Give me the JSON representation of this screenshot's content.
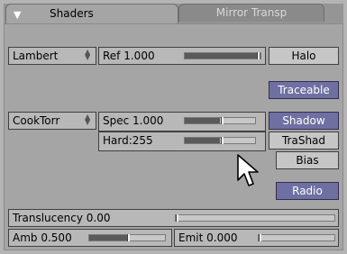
{
  "tabs": {
    "active": "Shaders",
    "inactive": "Mirror Transp"
  },
  "diffuse": {
    "shader": "Lambert",
    "ref": {
      "label": "Ref ",
      "value": "1.000",
      "fraction": 1.0
    }
  },
  "specular": {
    "shader": "CookTorr",
    "spec": {
      "label": "Spec ",
      "value": "1.000",
      "fraction": 0.5
    },
    "hard": {
      "label": "Hard:",
      "value": "255",
      "fraction": 0.5
    }
  },
  "toggles": {
    "halo": {
      "label": "Halo",
      "on": false
    },
    "traceable": {
      "label": "Traceable",
      "on": true
    },
    "shadow": {
      "label": "Shadow",
      "on": true
    },
    "trashad": {
      "label": "TraShad",
      "on": false
    },
    "bias": {
      "label": "Bias",
      "on": false
    },
    "radio": {
      "label": "Radio",
      "on": true
    }
  },
  "translucency": {
    "label": "Translucency ",
    "value": "0.00",
    "fraction": 0.0
  },
  "amb": {
    "label": "Amb ",
    "value": "0.500",
    "fraction": 0.5
  },
  "emit": {
    "label": "Emit ",
    "value": "0.000",
    "fraction": 0.0
  },
  "colors": {
    "toggle_on": "#6f6fa2",
    "panel_bg": "#a5a5a5",
    "button_bg": "#b8b8b8"
  }
}
